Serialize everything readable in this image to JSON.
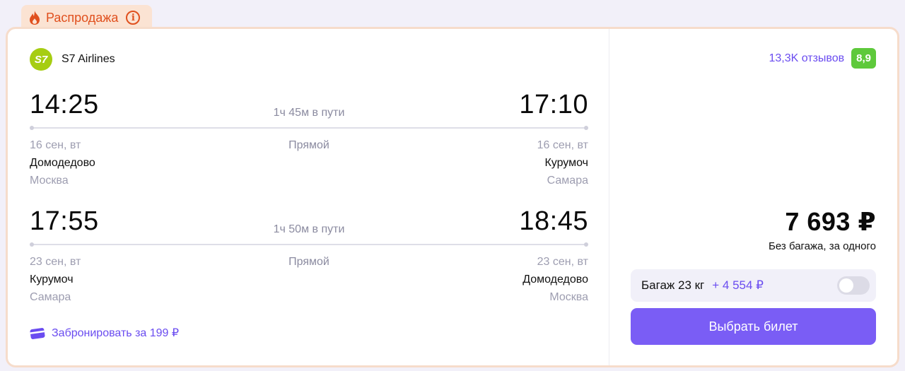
{
  "sale": {
    "label": "Распродажа"
  },
  "airline": {
    "logo_text": "S7",
    "name": "S7 Airlines"
  },
  "reviews": {
    "count": "13,3K отзывов",
    "rating": "8,9"
  },
  "segments": [
    {
      "dep_time": "14:25",
      "arr_time": "17:10",
      "duration": "1ч 45м в пути",
      "route_type": "Прямой",
      "dep_date": "16 сен, вт",
      "arr_date": "16 сен, вт",
      "dep_airport": "Домодедово",
      "arr_airport": "Курумоч",
      "dep_city": "Москва",
      "arr_city": "Самара"
    },
    {
      "dep_time": "17:55",
      "arr_time": "18:45",
      "duration": "1ч 50м в пути",
      "route_type": "Прямой",
      "dep_date": "23 сен, вт",
      "arr_date": "23 сен, вт",
      "dep_airport": "Курумоч",
      "arr_airport": "Домодедово",
      "dep_city": "Самара",
      "arr_city": "Москва"
    }
  ],
  "book": {
    "label": "Забронировать за 199 ₽"
  },
  "price": {
    "value": "7 693 ₽",
    "note": "Без багажа, за одного"
  },
  "baggage": {
    "label": "Багаж 23 кг",
    "price": "+ 4 554 ₽",
    "enabled": false
  },
  "select_button": {
    "label": "Выбрать билет"
  },
  "colors": {
    "accent": "#7a5df5",
    "sale": "#e0501e",
    "rating": "#5ec93b",
    "airline_logo": "#a6cd12"
  }
}
